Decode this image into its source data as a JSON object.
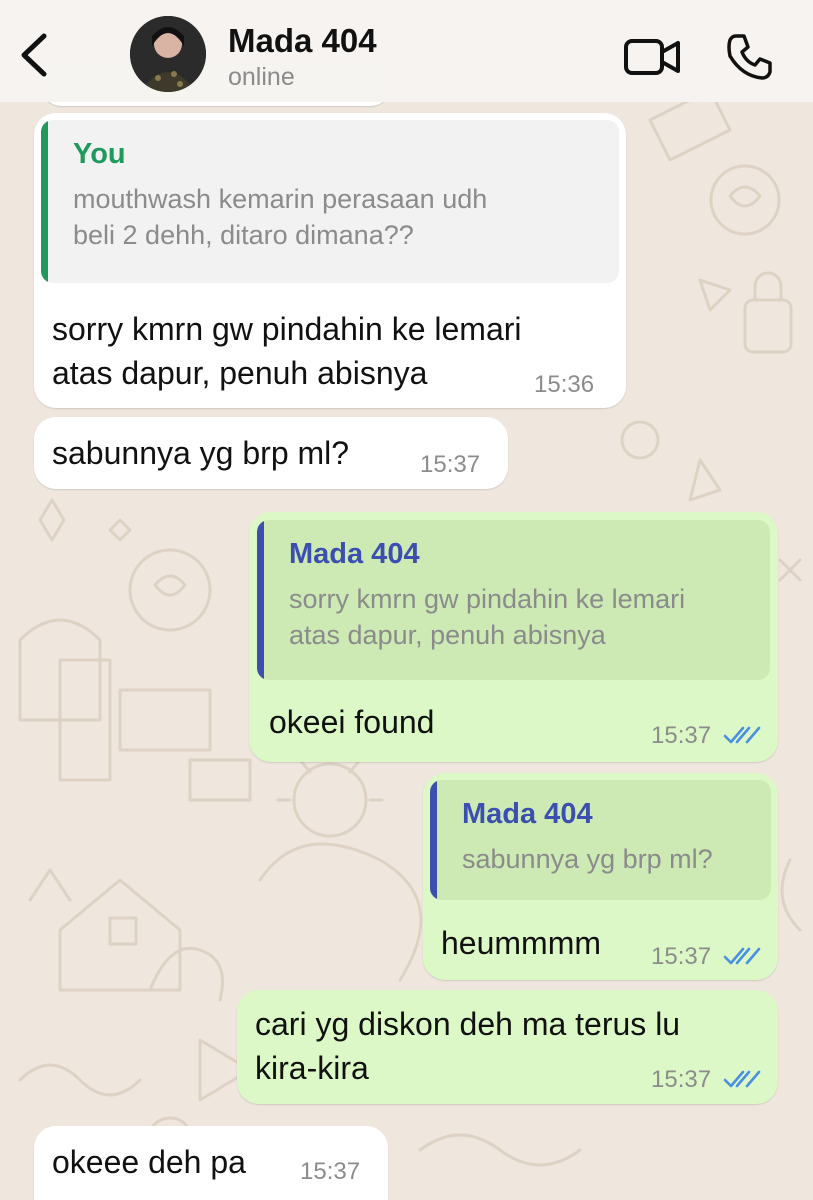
{
  "header": {
    "contact_name": "Mada 404",
    "status": "online",
    "icons": [
      "back-chevron-icon",
      "avatar",
      "video-call-icon",
      "phone-call-icon"
    ]
  },
  "colors": {
    "incoming_bubble": "#ffffff",
    "outgoing_bubble": "#dcf8c6",
    "quote_you_accent": "#1f9a5c",
    "quote_contact_accent": "#3c4fb0",
    "read_ticks": "#4a90e2",
    "wallpaper": "#efe7de"
  },
  "messages": [
    {
      "direction": "in",
      "quote": {
        "author": "You",
        "text_lines": [
          "mouthwash kemarin perasaan udh",
          "beli 2 dehh, ditaro dimana??"
        ]
      },
      "text_lines": [
        "sorry kmrn gw pindahin ke lemari",
        "atas dapur, penuh abisnya"
      ],
      "time": "15:36"
    },
    {
      "direction": "in",
      "text_lines": [
        "sabunnya yg brp ml?"
      ],
      "time": "15:37"
    },
    {
      "direction": "out",
      "quote": {
        "author": "Mada 404",
        "text_lines": [
          "sorry kmrn gw pindahin ke lemari",
          "atas dapur, penuh abisnya"
        ]
      },
      "text_lines": [
        "okeei found"
      ],
      "time": "15:37",
      "status": "read"
    },
    {
      "direction": "out",
      "quote": {
        "author": "Mada 404",
        "text_lines": [
          "sabunnya yg brp ml?"
        ]
      },
      "text_lines": [
        "heummmm"
      ],
      "time": "15:37",
      "status": "read"
    },
    {
      "direction": "out",
      "text_lines": [
        "cari yg diskon deh ma terus lu",
        "kira-kira"
      ],
      "time": "15:37",
      "status": "read"
    },
    {
      "direction": "in",
      "text_lines": [
        "okeee deh pa"
      ],
      "time": "15:37"
    }
  ]
}
